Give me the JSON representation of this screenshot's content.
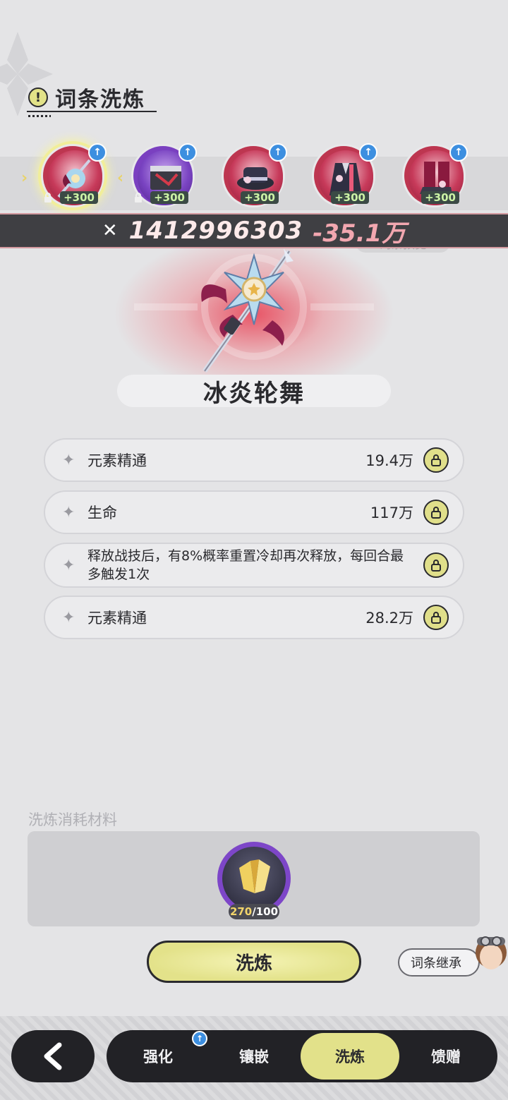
{
  "header": {
    "title": "词条洗炼",
    "title_icon": "exclamation-icon"
  },
  "equipment": [
    {
      "name": "weapon",
      "level_badge": "+300",
      "selected": true,
      "locked": true,
      "upgrade": true,
      "frame_color": "#bd3650"
    },
    {
      "name": "book",
      "level_badge": "+300",
      "selected": false,
      "locked": true,
      "upgrade": true,
      "frame_color": "#7a40c0"
    },
    {
      "name": "hat",
      "level_badge": "+300",
      "selected": false,
      "locked": false,
      "upgrade": true,
      "frame_color": "#bd3650"
    },
    {
      "name": "coat",
      "level_badge": "+300",
      "selected": false,
      "locked": false,
      "upgrade": true,
      "frame_color": "#bd3650"
    },
    {
      "name": "boots",
      "level_badge": "+300",
      "selected": false,
      "locked": false,
      "upgrade": true,
      "frame_color": "#bd3650"
    }
  ],
  "power": {
    "value": "1412996303",
    "delta": "-35.1万"
  },
  "preview_button": "词条预览",
  "weapon": {
    "name": "冰炎轮舞"
  },
  "stats": [
    {
      "label": "元素精通",
      "value": "19.4万"
    },
    {
      "label": "生命",
      "value": "117万"
    },
    {
      "label": "释放战技后，有8%概率重置冷却再次释放，每回合最多触发1次",
      "value": ""
    },
    {
      "label": "元素精通",
      "value": "28.2万"
    }
  ],
  "materials": {
    "title": "洗炼消耗材料",
    "owned": "270",
    "separator": "/",
    "required": "100"
  },
  "actions": {
    "refine": "洗炼",
    "inherit": "词条继承"
  },
  "nav": {
    "tabs": [
      "强化",
      "镶嵌",
      "洗炼",
      "馈赠"
    ],
    "active": "洗炼"
  },
  "colors": {
    "accent": "#e2e18a",
    "dark": "#222226",
    "power_delta": "#f2a7b0"
  }
}
